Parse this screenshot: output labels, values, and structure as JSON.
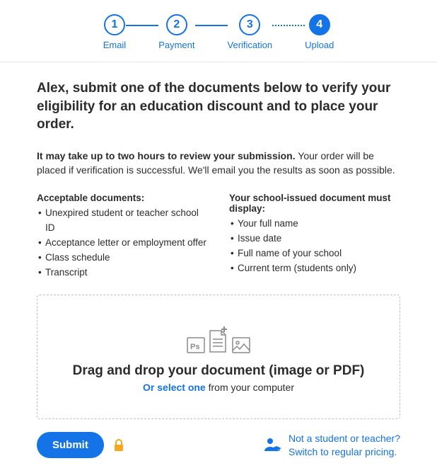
{
  "stepper": {
    "steps": [
      {
        "num": "1",
        "label": "Email"
      },
      {
        "num": "2",
        "label": "Payment"
      },
      {
        "num": "3",
        "label": "Verification"
      },
      {
        "num": "4",
        "label": "Upload"
      }
    ]
  },
  "title": "Alex, submit one of the documents below to verify your eligibility for an education discount and to place your order.",
  "notice": {
    "bold": "It may take up to two hours to review your submission.",
    "rest": " Your order will be placed if verification is successful. We'll email you the results as soon as possible."
  },
  "columns": {
    "acceptable": {
      "title": "Acceptable documents:",
      "items": [
        "Unexpired student or teacher school ID",
        "Acceptance letter or employment offer",
        "Class schedule",
        "Transcript"
      ]
    },
    "requirements": {
      "title": "Your school-issued document must display:",
      "items": [
        "Your full name",
        "Issue date",
        "Full name of your school",
        "Current term (students only)"
      ]
    }
  },
  "dropzone": {
    "main": "Drag and drop your document (image or PDF)",
    "link": "Or select one",
    "rest": " from your computer"
  },
  "footer": {
    "submit": "Submit",
    "line1": "Not a student or teacher?",
    "line2": "Switch to regular pricing."
  }
}
